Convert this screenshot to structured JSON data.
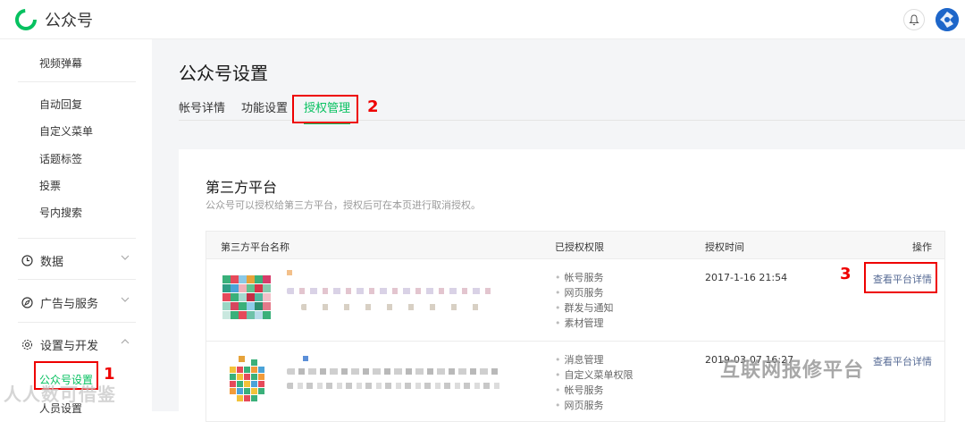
{
  "app": {
    "title": "公众号"
  },
  "sidebar": {
    "items": [
      {
        "label": "视频弹幕"
      },
      {
        "label": "自动回复"
      },
      {
        "label": "自定义菜单"
      },
      {
        "label": "话题标签"
      },
      {
        "label": "投票"
      },
      {
        "label": "号内搜索"
      }
    ],
    "groups": [
      {
        "label": "数据",
        "icon": "clock-icon"
      },
      {
        "label": "广告与服务",
        "icon": "compass-icon"
      },
      {
        "label": "设置与开发",
        "icon": "gear-icon"
      }
    ],
    "sub_items": [
      {
        "label": "公众号设置"
      },
      {
        "label": "人员设置"
      }
    ]
  },
  "main": {
    "title": "公众号设置",
    "tabs": [
      {
        "label": "帐号详情"
      },
      {
        "label": "功能设置"
      },
      {
        "label": "授权管理",
        "active": true
      }
    ],
    "section": {
      "title": "第三方平台",
      "desc": "公众号可以授权给第三方平台，授权后可在本页进行取消授权。",
      "columns": [
        "第三方平台名称",
        "已授权权限",
        "授权时间",
        "操作"
      ],
      "rows": [
        {
          "permissions": [
            "帐号服务",
            "网页服务",
            "群发与通知",
            "素材管理"
          ],
          "time": "2017-1-16 21:54",
          "action": "查看平台详情"
        },
        {
          "permissions": [
            "消息管理",
            "自定义菜单权限",
            "帐号服务",
            "网页服务"
          ],
          "time": "2019-03-07 16:27",
          "action": "查看平台详情"
        }
      ]
    }
  },
  "annotations": {
    "n1": "1",
    "n2": "2",
    "n3": "3"
  },
  "watermarks": {
    "left": "人人数可借鉴",
    "right": "互联网报修平台"
  },
  "colors": {
    "accent": "#07c160",
    "link": "#576b95",
    "annotation": "#e00000"
  }
}
